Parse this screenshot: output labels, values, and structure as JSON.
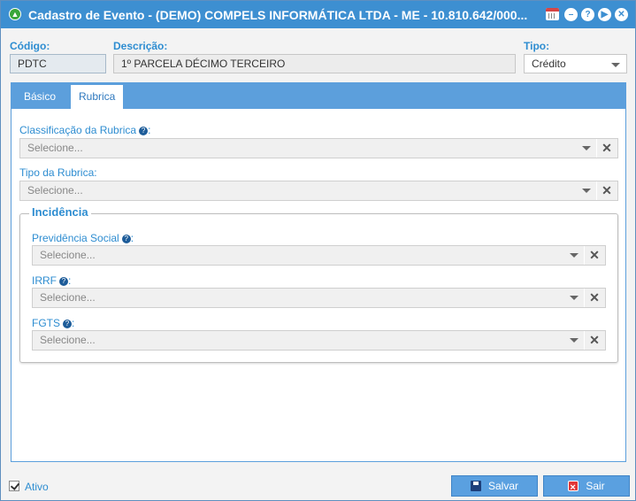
{
  "window": {
    "title": "Cadastro de Evento - (DEMO) COMPELS INFORMÁTICA LTDA - ME - 10.810.642/000..."
  },
  "header": {
    "codigo_label": "Código:",
    "codigo_value": "PDTC",
    "descricao_label": "Descrição:",
    "descricao_value": "1º PARCELA DÉCIMO TERCEIRO",
    "tipo_label": "Tipo:",
    "tipo_value": "Crédito"
  },
  "tabs": [
    {
      "label": "Básico",
      "active": false
    },
    {
      "label": "Rubrica",
      "active": true
    }
  ],
  "rubrica": {
    "classificacao_label": "Classificação da Rubrica",
    "classificacao_placeholder": "Selecione...",
    "tipo_label": "Tipo da Rubrica:",
    "tipo_placeholder": "Selecione...",
    "incidencia": {
      "legend": "Incidência",
      "previdencia_label": "Previdência Social",
      "previdencia_placeholder": "Selecione...",
      "irrf_label": "IRRF",
      "irrf_placeholder": "Selecione...",
      "fgts_label": "FGTS",
      "fgts_placeholder": "Selecione..."
    }
  },
  "footer": {
    "ativo_label": "Ativo",
    "ativo_checked": true,
    "save_label": "Salvar",
    "exit_label": "Sair"
  },
  "colors": {
    "titlebar": "#3d8fd1",
    "accent": "#2e8dd1",
    "tabbar": "#5c9fdc",
    "button": "#5aa0e0"
  },
  "icons": [
    "app-status-icon",
    "calendar-icon",
    "minimize-icon",
    "help-icon",
    "next-icon",
    "close-icon",
    "help-icon",
    "chevron-down-icon",
    "clear-icon",
    "checkbox-checked-icon",
    "save-icon",
    "exit-icon"
  ]
}
